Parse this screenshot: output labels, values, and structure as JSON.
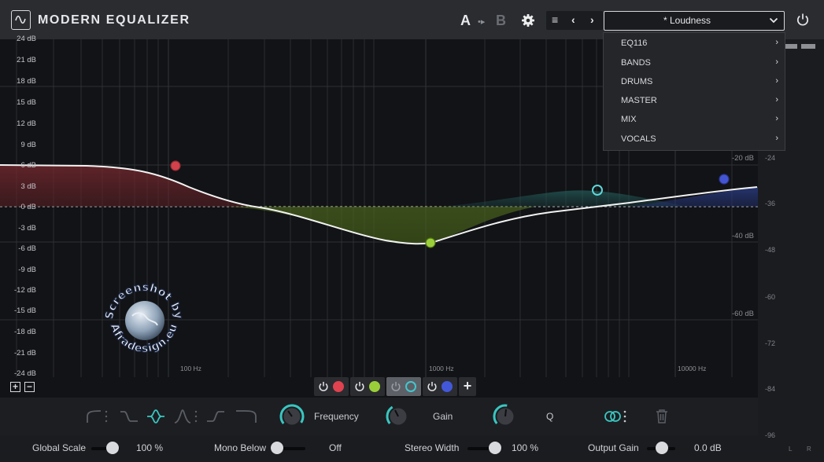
{
  "header": {
    "title": "MODERN EQUALIZER",
    "ab_a": "A",
    "ab_b": "B",
    "ab_arrow": "•▸",
    "preset_value": "* Loudness"
  },
  "nav": {
    "menu_glyph": "≡",
    "prev_glyph": "‹",
    "next_glyph": "›"
  },
  "preset_menu": {
    "items": [
      {
        "label": "EQ116",
        "arrow": "›"
      },
      {
        "label": "BANDS",
        "arrow": "›"
      },
      {
        "label": "DRUMS",
        "arrow": "›"
      },
      {
        "label": "MASTER",
        "arrow": "›"
      },
      {
        "label": "MIX",
        "arrow": "›"
      },
      {
        "label": "VOCALS",
        "arrow": "›"
      }
    ]
  },
  "graph": {
    "db_labels": [
      "24 dB",
      "21 dB",
      "18 dB",
      "15 dB",
      "12 dB",
      "9 dB",
      "6 dB",
      "3 dB",
      "0 dB",
      "-3 dB",
      "-6 dB",
      "-9 dB",
      "-12 dB",
      "-15 dB",
      "-18 dB",
      "-21 dB",
      "-24 dB"
    ],
    "freq_labels": [
      "100 Hz",
      "1000 Hz",
      "10000 Hz"
    ],
    "inner_db_labels": [
      "-20 dB",
      "-40 dB",
      "-60 dB"
    ],
    "zoom_in": "+",
    "zoom_out": "−"
  },
  "meter": {
    "scale": [
      "-24",
      "-36",
      "-48",
      "-60",
      "-72",
      "-84",
      "-96"
    ],
    "channel_left": "L",
    "channel_right": "R"
  },
  "bands": [
    {
      "color": "#e0424f",
      "selected": false,
      "enabled": true
    },
    {
      "color": "#9bcf3a",
      "selected": false,
      "enabled": true
    },
    {
      "color": "#42c7cf",
      "selected": true,
      "enabled": false
    },
    {
      "color": "#4358d8",
      "selected": false,
      "enabled": true
    }
  ],
  "band_add": "+",
  "band_controls": {
    "frequency_label": "Frequency",
    "gain_label": "Gain",
    "q_label": "Q",
    "accent": "#39c6c0"
  },
  "global": {
    "global_scale_label": "Global Scale",
    "global_scale_value": "100 %",
    "mono_below_label": "Mono Below",
    "mono_below_value": "Off",
    "stereo_width_label": "Stereo Width",
    "stereo_width_value": "100 %",
    "output_gain_label": "Output Gain",
    "output_gain_value": "0.0 dB"
  },
  "watermark": {
    "text_top": "Screenshot by",
    "text_bottom": "Afradesign.eu"
  }
}
